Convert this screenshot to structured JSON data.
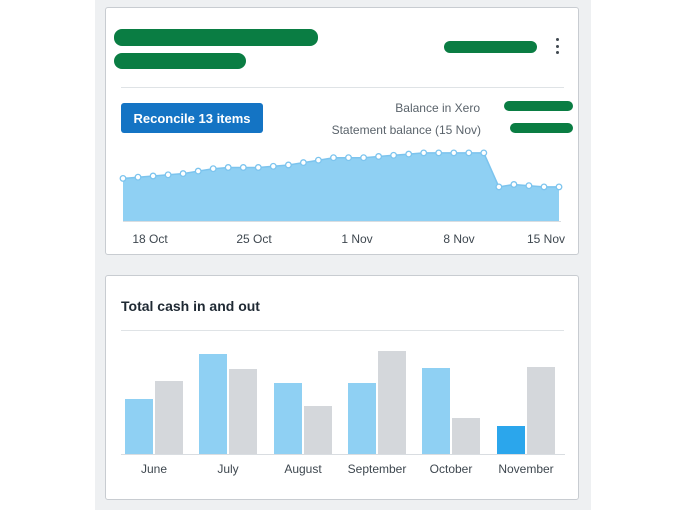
{
  "colors": {
    "accent": "#1474c4",
    "area_fill": "#8fd0f3",
    "line": "#7cc4ee",
    "bar_in": "#8fd0f3",
    "bar_out": "#d4d7db",
    "bar_current": "#2ba6ec",
    "redaction": "#0a7d43"
  },
  "bank_card": {
    "menu_icon": "more-vertical-icon",
    "reconcile_button": "Reconcile 13 items",
    "balance_label": "Balance in Xero",
    "statement_label": "Statement balance (15 Nov)"
  },
  "cash_card": {
    "title": "Total cash in and out"
  },
  "chart_data": [
    {
      "type": "area",
      "x_tick_labels": [
        "18 Oct",
        "25 Oct",
        "1 Nov",
        "8 Nov",
        "15 Nov"
      ],
      "values": [
        35,
        36,
        37,
        38,
        39,
        41,
        43,
        44,
        44,
        44,
        45,
        46,
        48,
        50,
        52,
        52,
        52,
        53,
        54,
        55,
        56,
        56,
        56,
        56,
        56,
        28,
        30,
        29,
        28,
        28
      ],
      "grid": false,
      "legend": "none"
    },
    {
      "type": "bar",
      "categories": [
        "June",
        "July",
        "August",
        "September",
        "October",
        "November"
      ],
      "series": [
        {
          "values": [
            55,
            100,
            71,
            71,
            86,
            28
          ]
        },
        {
          "values": [
            73,
            85,
            48,
            103,
            36,
            87
          ]
        }
      ],
      "highlight_last_category": true,
      "grid": false,
      "legend": "none"
    }
  ]
}
